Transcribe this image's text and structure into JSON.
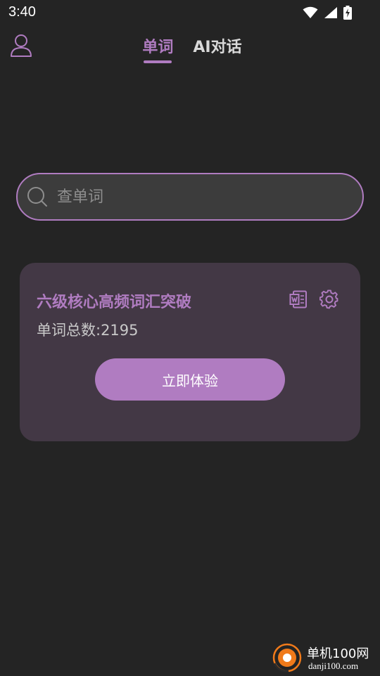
{
  "status_bar": {
    "time": "3:40",
    "icons": [
      "wifi-icon",
      "cellular-signal-icon",
      "battery-charging-icon"
    ]
  },
  "header": {
    "user_icon": "user-icon",
    "tabs": [
      {
        "label": "单词",
        "active": true
      },
      {
        "label": "AI对话",
        "active": false
      }
    ]
  },
  "search": {
    "placeholder": "查单词",
    "value": ""
  },
  "wordbook": {
    "title": "六级核心高频词汇突破",
    "count_text": "单词总数:2195",
    "start_label": "立即体验",
    "icons": [
      "word-document-icon",
      "settings-gear-icon"
    ]
  },
  "watermark": {
    "site_name": "单机100网",
    "site_url": "danji100.com"
  },
  "colors": {
    "background": "#242424",
    "accent": "#b07cc1",
    "card": "#433845",
    "search_fill": "#3c3c3c"
  }
}
